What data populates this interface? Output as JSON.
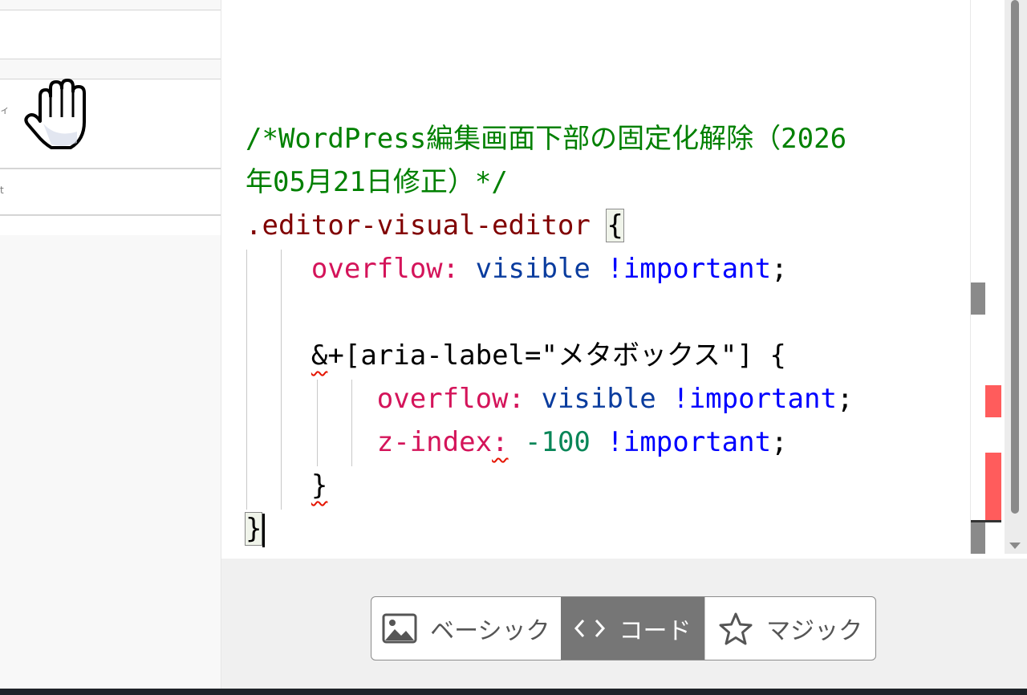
{
  "editor": {
    "lines": [
      [
        {
          "t": "/*WordPress編集画面下部の固定化解除（2026",
          "c": "c-comment"
        }
      ],
      [
        {
          "t": "年05月21日修正）*/",
          "c": "c-comment"
        }
      ],
      [
        {
          "t": ".editor-visual-editor",
          "c": "c-sel"
        },
        {
          "t": " ",
          "c": "c-punc"
        },
        {
          "t": "{",
          "c": "c-punc bracket-hl"
        }
      ],
      [
        {
          "t": "    ",
          "c": "c-punc"
        },
        {
          "t": "overflow:",
          "c": "c-prop"
        },
        {
          "t": " visible ",
          "c": "c-val"
        },
        {
          "t": "!important",
          "c": "c-imp"
        },
        {
          "t": ";",
          "c": "c-punc"
        }
      ],
      [
        {
          "t": " ",
          "c": "c-punc"
        }
      ],
      [
        {
          "t": "    ",
          "c": "c-punc"
        },
        {
          "t": "&",
          "c": "c-punc squiggle"
        },
        {
          "t": "+[aria-label=\"メタボックス\"] {",
          "c": "c-punc"
        }
      ],
      [
        {
          "t": "        ",
          "c": "c-punc"
        },
        {
          "t": "overflow:",
          "c": "c-prop"
        },
        {
          "t": " visible ",
          "c": "c-val"
        },
        {
          "t": "!important",
          "c": "c-imp"
        },
        {
          "t": ";",
          "c": "c-punc"
        }
      ],
      [
        {
          "t": "        ",
          "c": "c-punc"
        },
        {
          "t": "z-index",
          "c": "c-prop"
        },
        {
          "t": ":",
          "c": "c-prop squiggle"
        },
        {
          "t": " -100 ",
          "c": "c-num"
        },
        {
          "t": "!important",
          "c": "c-imp"
        },
        {
          "t": ";",
          "c": "c-punc"
        }
      ],
      [
        {
          "t": "    ",
          "c": "c-punc"
        },
        {
          "t": "}",
          "c": "c-punc squiggle"
        }
      ],
      [
        {
          "t": "}",
          "c": "c-punc bracket-hl"
        }
      ]
    ],
    "caret_line": 9
  },
  "left_panel": {
    "snippet_1": "ィ",
    "snippet_2": "t"
  },
  "mode_switch": {
    "basic_label": "ベーシック",
    "code_label": "コード",
    "magic_label": "マジック",
    "active": "code"
  },
  "icons": {
    "basic": "image-icon",
    "code": "code-brackets-icon",
    "magic": "star-icon",
    "cursor": "hand-cursor-icon"
  },
  "colors": {
    "comment": "#008000",
    "selector": "#800000",
    "property": "#d4145a",
    "value": "#0a3c9e",
    "important": "#0000ff",
    "number": "#098658",
    "active_tab": "#767676",
    "error_mark": "#ff5c5c"
  }
}
